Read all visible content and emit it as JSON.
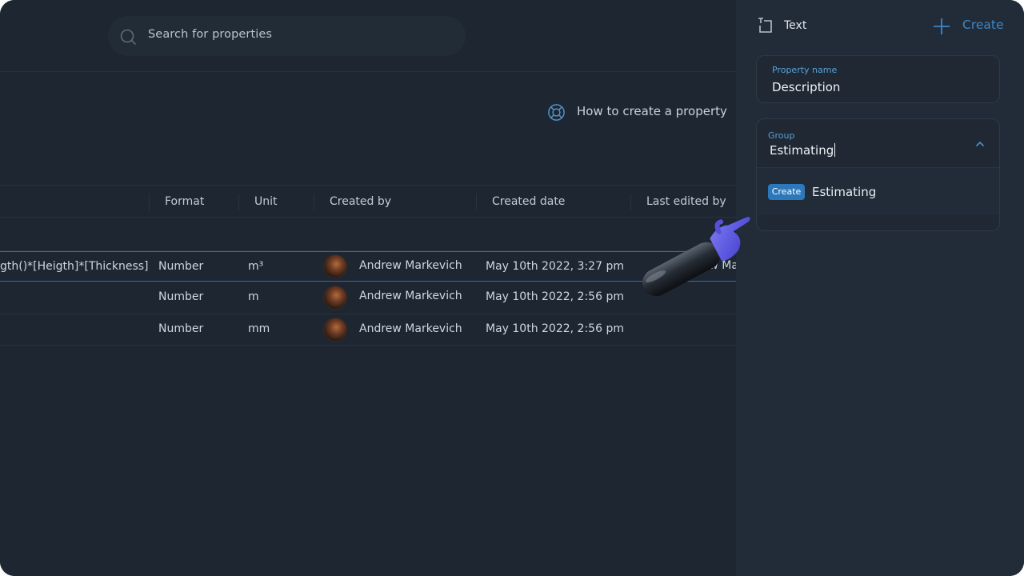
{
  "search": {
    "placeholder": "Search for properties",
    "icon": "search-icon"
  },
  "help_link": {
    "label": "How to create a property",
    "icon": "lifebuoy-icon"
  },
  "table": {
    "columns": [
      "Format",
      "Unit",
      "Created by",
      "Created date",
      "Last edited by"
    ],
    "rows": [
      {
        "formula": "gth()*[Heigth]*[Thickness]",
        "format": "Number",
        "unit": "m³",
        "created_by": "Andrew Markevich",
        "created_date": "May 10th 2022, 3:27 pm",
        "last_edited_by": "Andrew Mar",
        "selected": true
      },
      {
        "formula": "",
        "format": "Number",
        "unit": "m",
        "created_by": "Andrew Markevich",
        "created_date": "May 10th 2022, 2:56 pm",
        "last_edited_by": ""
      },
      {
        "formula": "",
        "format": "Number",
        "unit": "mm",
        "created_by": "Andrew Markevich",
        "created_date": "May 10th 2022, 2:56 pm",
        "last_edited_by": ""
      }
    ]
  },
  "panel": {
    "type_label": "Text",
    "create_label": "Create",
    "property_name": {
      "label": "Property name",
      "value": "Description"
    },
    "group": {
      "label": "Group",
      "value": "Estimating",
      "option": {
        "badge": "Create",
        "label": "Estimating"
      }
    }
  },
  "colors": {
    "accent": "#3d87c6",
    "badge": "#2d78bb",
    "panel": "#222c38",
    "main": "#1d2631"
  }
}
